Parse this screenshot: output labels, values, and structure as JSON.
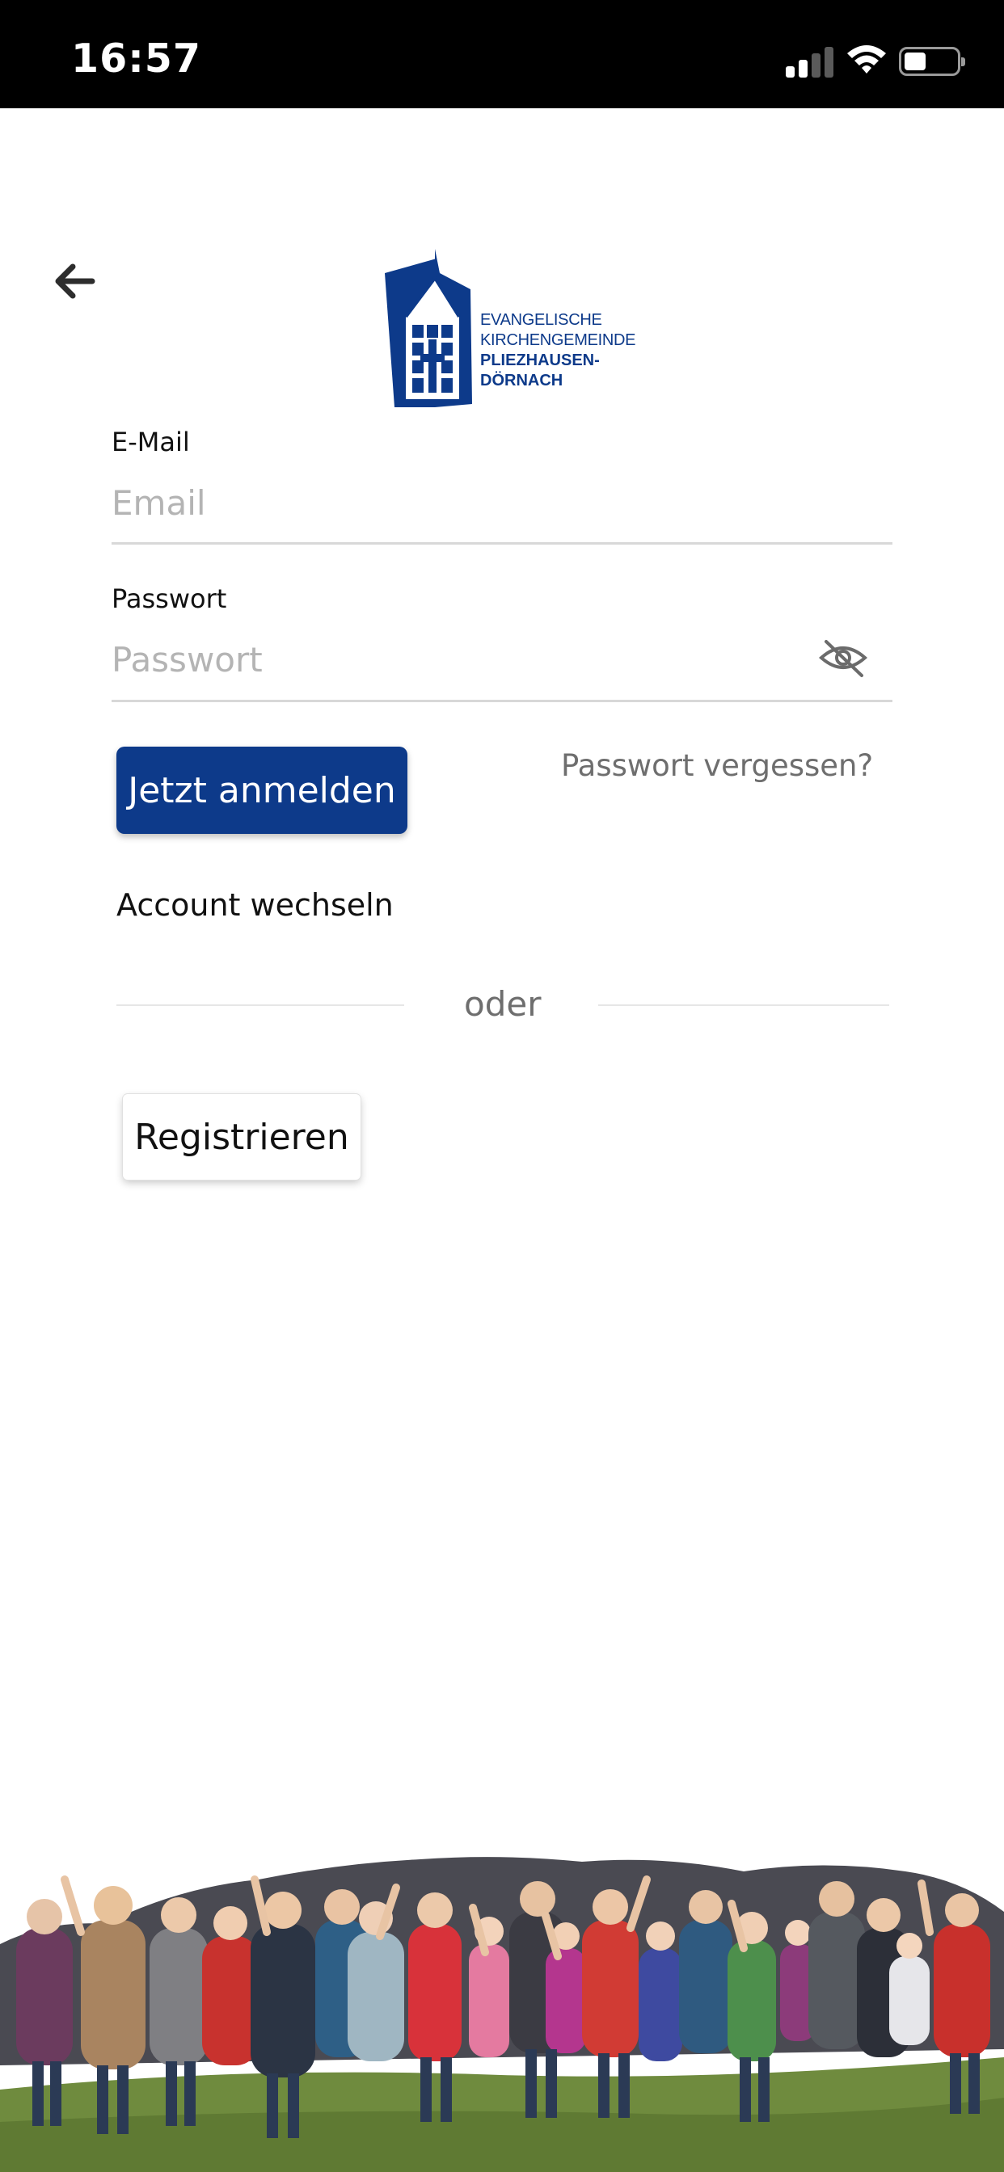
{
  "status_bar": {
    "time": "16:57"
  },
  "logo": {
    "line1": "EVANGELISCHE",
    "line2": "KIRCHENGEMEINDE",
    "line3": "PLIEZHAUSEN-",
    "line4": "DÖRNACH"
  },
  "form": {
    "email_label": "E-Mail",
    "email_placeholder": "Email",
    "email_value": "",
    "password_label": "Passwort",
    "password_placeholder": "Passwort",
    "password_value": ""
  },
  "actions": {
    "login_label": "Jetzt anmelden",
    "forgot_label": "Passwort vergessen?",
    "switch_account_label": "Account wechseln",
    "divider_text": "oder",
    "register_label": "Registrieren"
  },
  "icons": {
    "back": "arrow-left-icon",
    "password_toggle": "eye-slash-icon"
  },
  "colors": {
    "brand": "#0d3a8a",
    "status_bar": "#000000",
    "muted_text": "#6e6e6e"
  }
}
